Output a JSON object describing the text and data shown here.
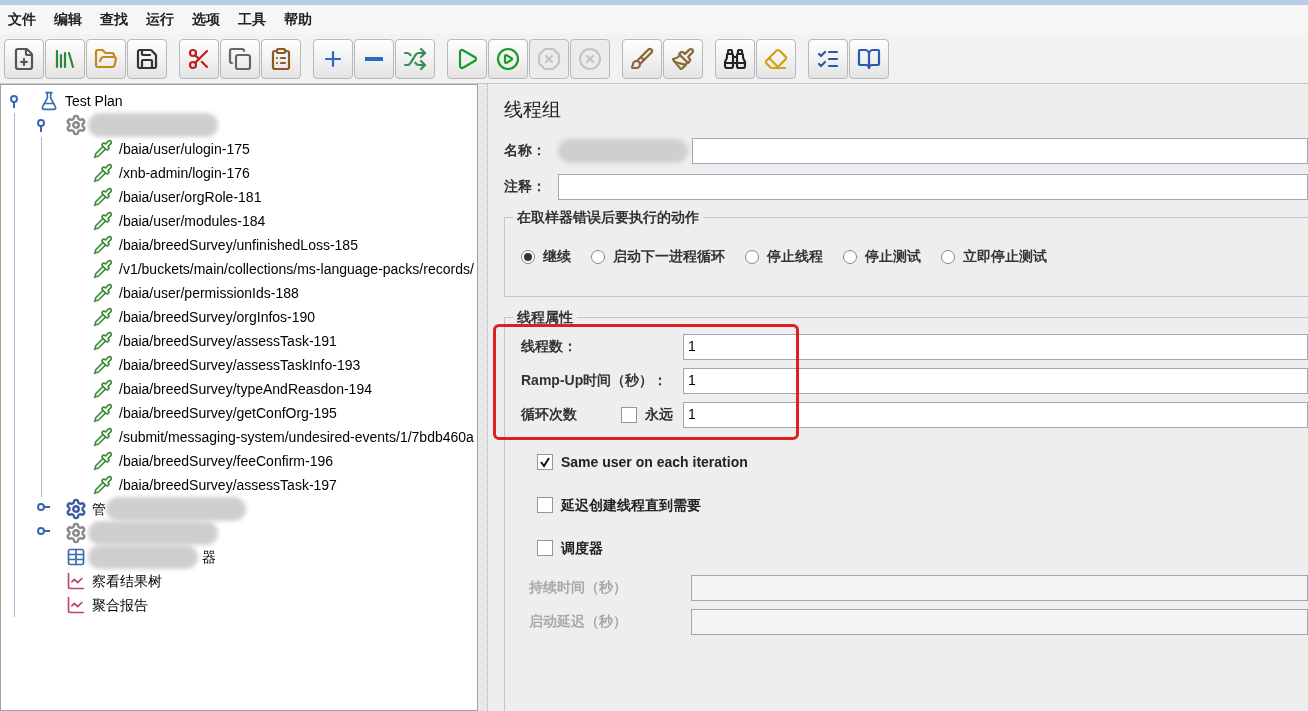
{
  "menu": [
    "文件",
    "编辑",
    "查找",
    "运行",
    "选项",
    "工具",
    "帮助"
  ],
  "toolbar": [
    [
      {
        "kind": "new",
        "disabled": false
      },
      {
        "kind": "templates",
        "disabled": false
      },
      {
        "kind": "open",
        "disabled": false
      },
      {
        "kind": "save",
        "disabled": false
      }
    ],
    [
      {
        "kind": "cut",
        "disabled": false
      },
      {
        "kind": "copy",
        "disabled": false
      },
      {
        "kind": "paste",
        "disabled": false
      }
    ],
    [
      {
        "kind": "expand",
        "disabled": false
      },
      {
        "kind": "collapse",
        "disabled": false
      },
      {
        "kind": "toggle",
        "disabled": false
      }
    ],
    [
      {
        "kind": "start",
        "disabled": false
      },
      {
        "kind": "start-no-pause",
        "disabled": false
      },
      {
        "kind": "stop",
        "disabled": true
      },
      {
        "kind": "shutdown",
        "disabled": true
      }
    ],
    [
      {
        "kind": "clear",
        "disabled": false
      },
      {
        "kind": "clear-all",
        "disabled": false
      }
    ],
    [
      {
        "kind": "search",
        "disabled": false
      },
      {
        "kind": "reset-search",
        "disabled": false
      }
    ],
    [
      {
        "kind": "function-helper",
        "disabled": false
      },
      {
        "kind": "help",
        "disabled": false
      }
    ]
  ],
  "tree": [
    {
      "kind": "plan",
      "label": "Test Plan",
      "expanded": true,
      "children": [
        {
          "kind": "thread-group",
          "redacted": true,
          "expanded": true,
          "children": [
            {
              "kind": "sampler",
              "label": "/baia/user/ulogin-175"
            },
            {
              "kind": "sampler",
              "label": "/xnb-admin/login-176"
            },
            {
              "kind": "sampler",
              "label": "/baia/user/orgRole-181"
            },
            {
              "kind": "sampler",
              "label": "/baia/user/modules-184"
            },
            {
              "kind": "sampler",
              "label": "/baia/breedSurvey/unfinishedLoss-185"
            },
            {
              "kind": "sampler",
              "label": "/v1/buckets/main/collections/ms-language-packs/records/"
            },
            {
              "kind": "sampler",
              "label": "/baia/user/permissionIds-188"
            },
            {
              "kind": "sampler",
              "label": "/baia/breedSurvey/orgInfos-190"
            },
            {
              "kind": "sampler",
              "label": "/baia/breedSurvey/assessTask-191"
            },
            {
              "kind": "sampler",
              "label": "/baia/breedSurvey/assessTaskInfo-193"
            },
            {
              "kind": "sampler",
              "label": "/baia/breedSurvey/typeAndReasdon-194"
            },
            {
              "kind": "sampler",
              "label": "/baia/breedSurvey/getConfOrg-195"
            },
            {
              "kind": "sampler",
              "label": "/submit/messaging-system/undesired-events/1/7bdb460a"
            },
            {
              "kind": "sampler",
              "label": "/baia/breedSurvey/feeConfirm-196"
            },
            {
              "kind": "sampler",
              "label": "/baia/breedSurvey/assessTask-197"
            }
          ]
        },
        {
          "kind": "setup-group",
          "label": "管",
          "redacted": true,
          "expanded": false
        },
        {
          "kind": "thread-group",
          "redacted": true,
          "expanded": false
        },
        {
          "kind": "listener-table",
          "label": "器",
          "redacted": true,
          "label_after_redaction": true
        },
        {
          "kind": "listener-graph",
          "label": "察看结果树"
        },
        {
          "kind": "listener-graph",
          "label": "聚合报告"
        }
      ]
    }
  ],
  "panel": {
    "title": "线程组",
    "name": {
      "label": "名称：",
      "blurred": true
    },
    "comment": {
      "label": "注释："
    },
    "on_error": {
      "legend": "在取样器错误后要执行的动作",
      "options": [
        {
          "label": "继续",
          "selected": true
        },
        {
          "label": "启动下一进程循环",
          "selected": false
        },
        {
          "label": "停止线程",
          "selected": false
        },
        {
          "label": "停止测试",
          "selected": false
        },
        {
          "label": "立即停止测试",
          "selected": false
        }
      ]
    },
    "thread_props": {
      "legend": "线程属性",
      "highlighted": true,
      "threads": {
        "label": "线程数：",
        "value": "1"
      },
      "ramp_up": {
        "label": "Ramp-Up时间（秒）：",
        "value": "1"
      },
      "loops": {
        "label": "循环次数",
        "forever": {
          "label": "永远",
          "checked": false
        },
        "value": "1"
      }
    },
    "checks": [
      {
        "label": "Same user on each iteration",
        "checked": true
      },
      {
        "label": "延迟创建线程直到需要",
        "checked": false
      },
      {
        "label": "调度器",
        "checked": false
      }
    ],
    "sched_fields": [
      {
        "label": "持续时间（秒）",
        "disabled": true
      },
      {
        "label": "启动延迟（秒）",
        "disabled": true
      }
    ]
  }
}
